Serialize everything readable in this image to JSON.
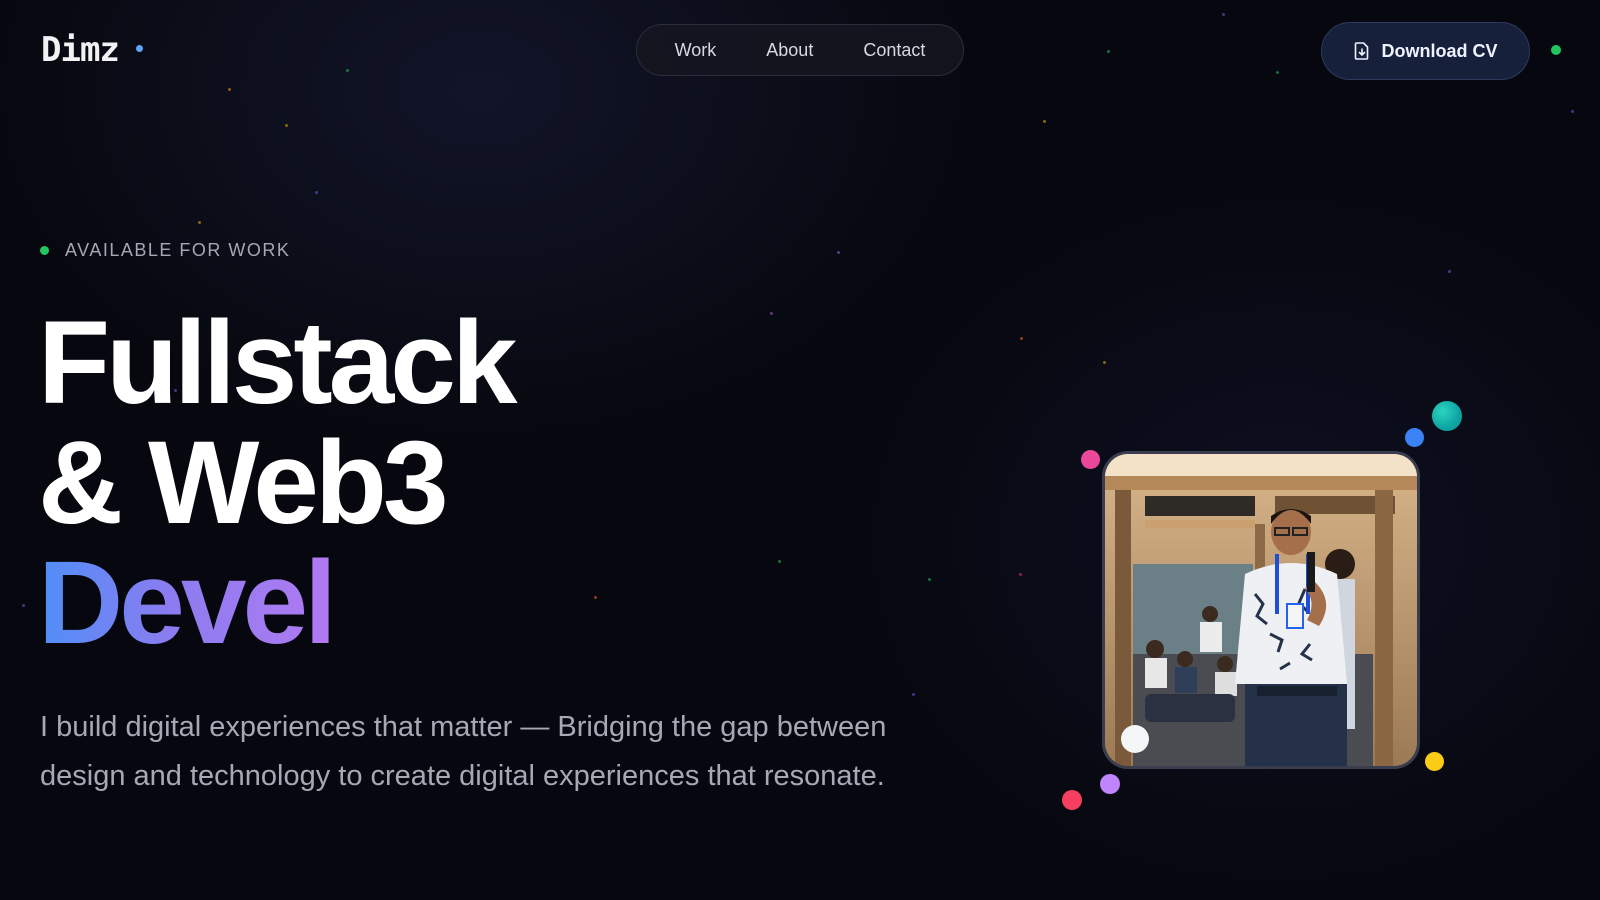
{
  "header": {
    "logo": "Dimz",
    "nav": [
      {
        "label": "Work"
      },
      {
        "label": "About"
      },
      {
        "label": "Contact"
      }
    ],
    "download_cv": "Download CV"
  },
  "hero": {
    "availability": "AVAILABLE FOR WORK",
    "title_line1": "Fullstack",
    "title_line2": "& Web3",
    "title_line3": "Devel",
    "description": "I build digital experiences that matter — Bridging the gap between design and technology to create digital experiences that resonate."
  },
  "colors": {
    "background": "#07080f",
    "accent_blue": "#4f8ff7",
    "accent_purple": "#b27af2",
    "status_green": "#22c55e",
    "button_bg": "#16203a"
  },
  "icons": {
    "download": "file-download-icon"
  }
}
